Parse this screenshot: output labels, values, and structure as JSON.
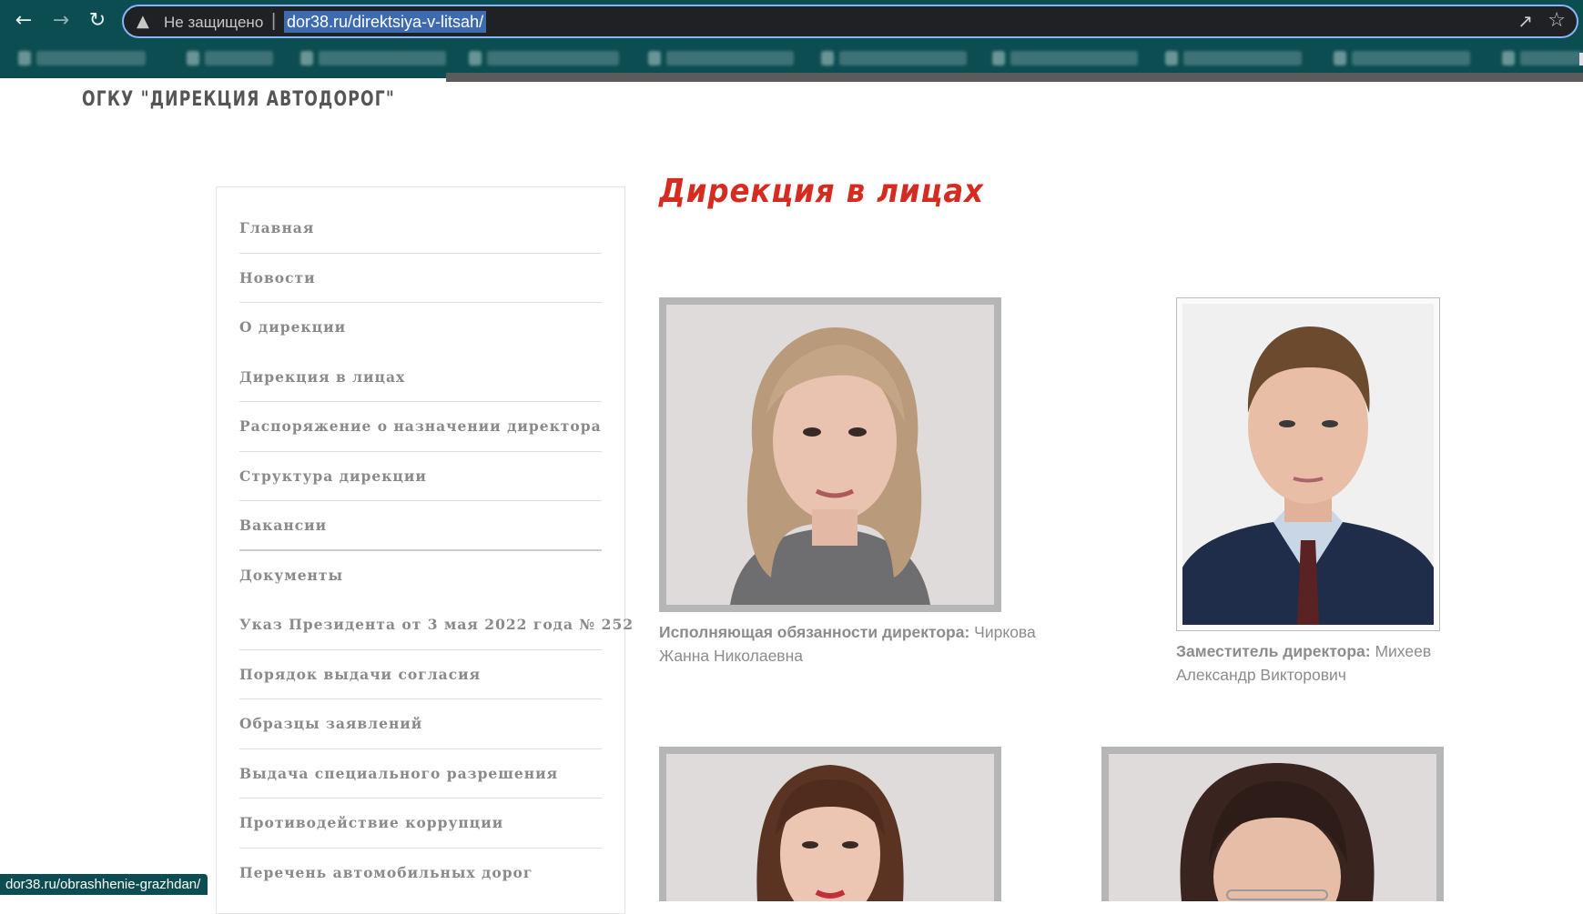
{
  "browser": {
    "security_label": "Не защищено",
    "url": "dor38.ru/direktsiya-v-litsah/",
    "status_url": "dor38.ru/obrashhenie-grazhdan/",
    "icons": [
      "back-arrow-icon",
      "forward-arrow-icon",
      "reload-icon",
      "warning-icon",
      "share-icon",
      "star-icon"
    ]
  },
  "site": {
    "title": "ОГКУ \"ДИРЕКЦИЯ АВТОДОРОГ\""
  },
  "sidebar": {
    "items": [
      {
        "label": "Главная"
      },
      {
        "label": "Новости"
      },
      {
        "label": "О дирекции"
      },
      {
        "label": "Дирекция в лицах"
      },
      {
        "label": "Распоряжение о назначении директора"
      },
      {
        "label": "Структура дирекции"
      },
      {
        "label": "Вакансии"
      },
      {
        "label": "Документы"
      },
      {
        "label": "Указ Президента от 3 мая 2022 года № 252"
      },
      {
        "label": "Порядок выдачи согласия"
      },
      {
        "label": "Образцы заявлений"
      },
      {
        "label": "Выдача специального разрешения"
      },
      {
        "label": "Противодействие коррупции"
      },
      {
        "label": "Перечень автомобильных дорог"
      }
    ]
  },
  "main": {
    "heading": "Дирекция в лицах",
    "people": [
      {
        "role": "Исполняющая обязанности директора:",
        "name": "Чиркова Жанна Николаевна"
      },
      {
        "role": "Заместитель директора:",
        "name": "Михеев Александр Викторович"
      }
    ]
  },
  "colors": {
    "chrome": "#0c4d52",
    "heading": "#d62b20",
    "menu_text": "#8a8a8a"
  }
}
